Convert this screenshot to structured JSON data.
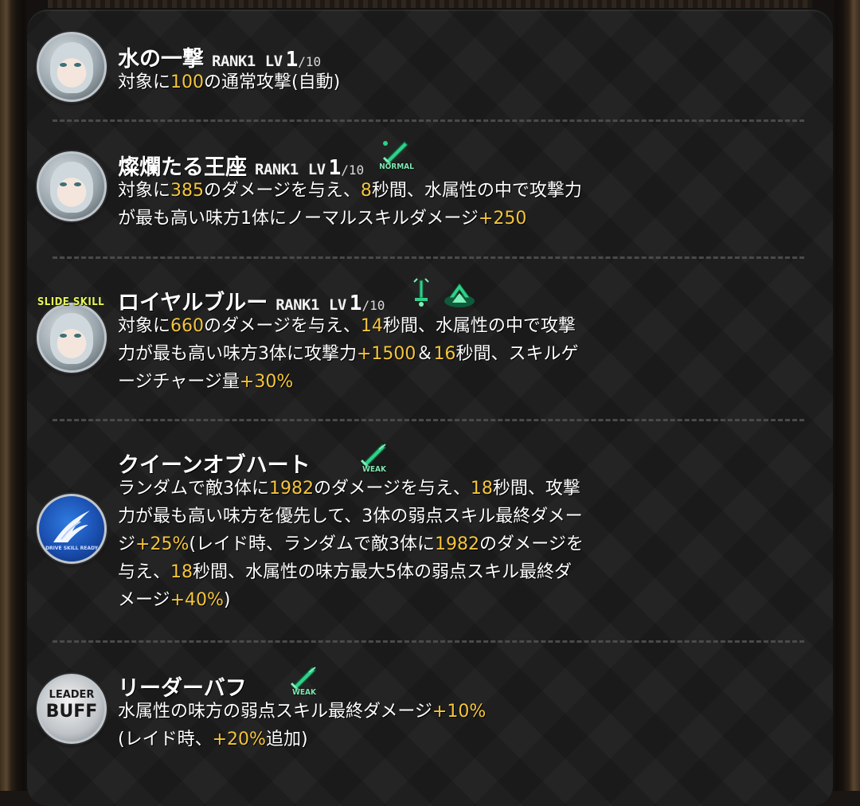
{
  "skills": [
    {
      "name": "水の一撃",
      "rank": "RANK1",
      "lv_label": "LV",
      "lv": "1",
      "lv_max": "/10",
      "desc_parts": [
        "対象に",
        "100",
        "の通常攻撃(自動)"
      ]
    },
    {
      "name": "燦爛たる王座",
      "rank": "RANK1",
      "lv_label": "LV",
      "lv": "1",
      "lv_max": "/10",
      "tag": "NORMAL",
      "tag_icon": "sword-icon",
      "desc_lines": [
        [
          "対象に",
          "385",
          "のダメージを与え、",
          "8",
          "秒間、水属性の中で攻撃力"
        ],
        [
          "が最も高い味方1体にノーマルスキルダメージ",
          "+250",
          ""
        ]
      ]
    },
    {
      "name": "ロイヤルブルー",
      "rank": "RANK1",
      "lv_label": "LV",
      "lv": "1",
      "lv_max": "/10",
      "badge": "SLIDE SKILL",
      "tag_icons": [
        "exclamation-sword-icon",
        "attack-up-icon"
      ],
      "desc_lines": [
        [
          "対象に",
          "660",
          "のダメージを与え、",
          "14",
          "秒間、水属性の中で攻撃"
        ],
        [
          "力が最も高い味方3体に攻撃力",
          "+1500",
          "＆",
          "16",
          "秒間、スキルゲ"
        ],
        [
          "ージチャージ量",
          "+30%",
          ""
        ]
      ]
    },
    {
      "name": "クイーンオブハート",
      "tag": "WEAK",
      "tag_icon": "sword-icon",
      "icon_text": "DRIVE SKILL READY",
      "desc_lines": [
        [
          "ランダムで敵3体に",
          "1982",
          "のダメージを与え、",
          "18",
          "秒間、攻撃"
        ],
        [
          "力が最も高い味方を優先して、3体の弱点スキル最終ダメー",
          "",
          ""
        ],
        [
          "ジ",
          "+25%",
          "(レイド時、ランダムで敵3体に",
          "1982",
          "のダメージを"
        ],
        [
          "与え、",
          "18",
          "秒間、水属性の味方最大5体の弱点スキル最終ダ"
        ],
        [
          "メージ",
          "+40%",
          ")"
        ]
      ]
    },
    {
      "name": "リーダーバフ",
      "tag": "WEAK",
      "tag_icon": "sword-icon",
      "icon_line1": "LEADER",
      "icon_line2": "BUFF",
      "desc_lines": [
        [
          "水属性の味方の弱点スキル最終ダメージ",
          "+10%",
          ""
        ],
        [
          "(レイド時、",
          "+20%",
          "追加)"
        ]
      ]
    }
  ],
  "colors": {
    "highlight": "#f5c53a",
    "text": "#ffffff",
    "tag_green": "#2fd08a"
  }
}
